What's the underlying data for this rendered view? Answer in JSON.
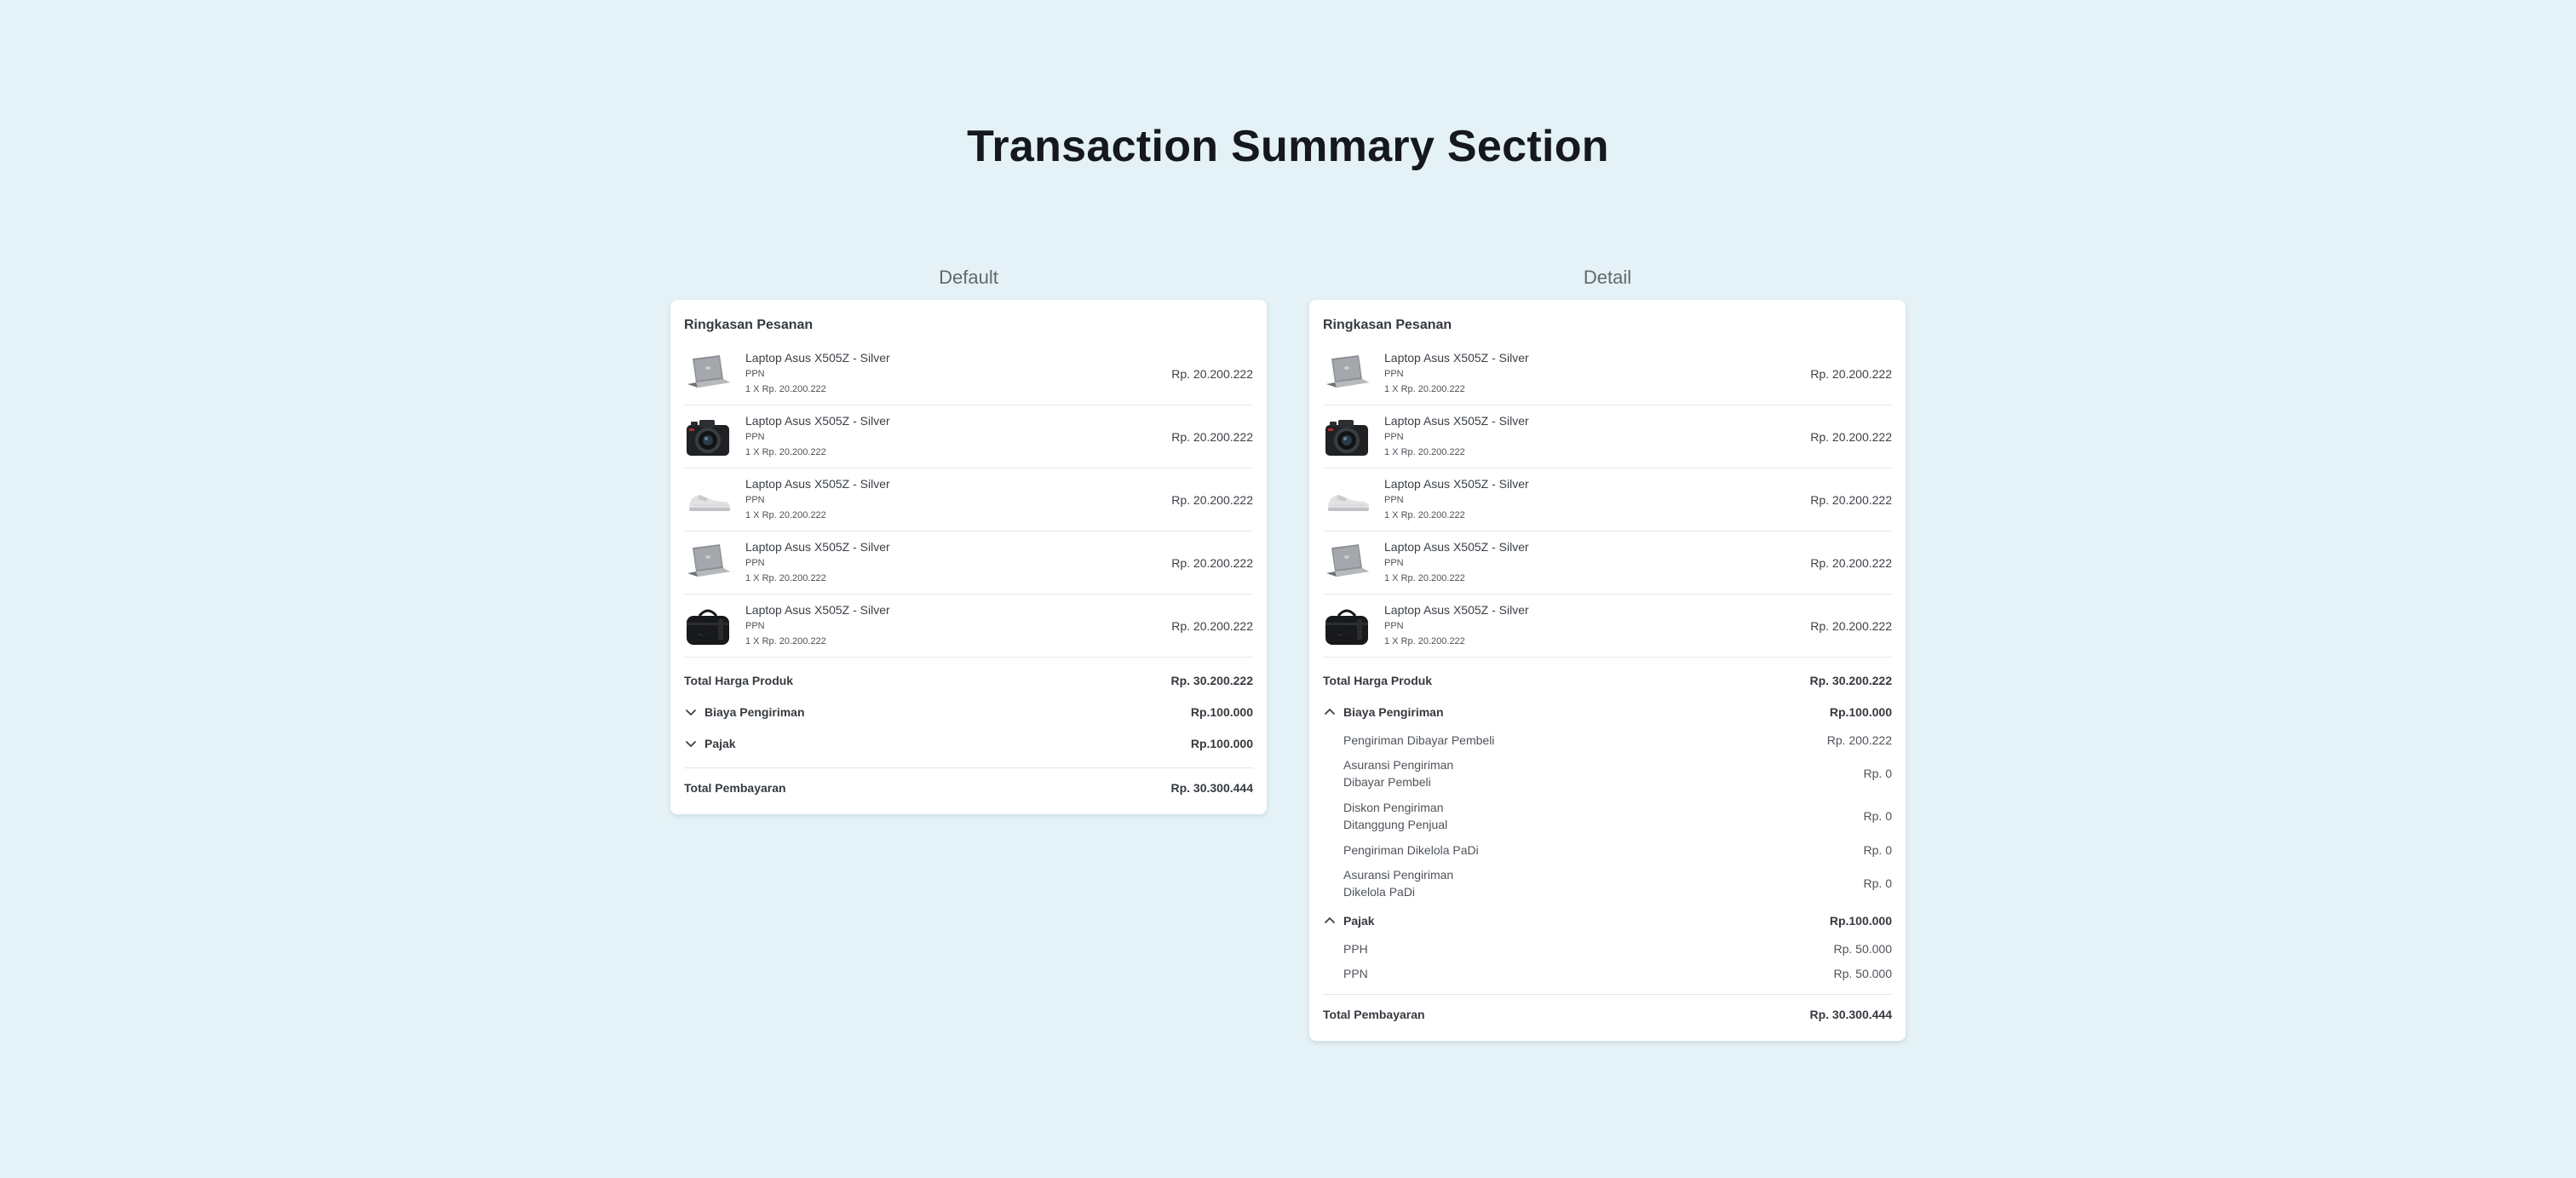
{
  "page_title": "Transaction Summary Section",
  "panels": [
    {
      "label": "Default",
      "card_title": "Ringkasan Pesanan",
      "items": [
        {
          "image": "laptop",
          "name": "Laptop Asus X505Z - Silver",
          "tax": "PPN",
          "qty_price": "1 X Rp. 20.200.222",
          "price": "Rp. 20.200.222"
        },
        {
          "image": "camera",
          "name": "Laptop Asus X505Z - Silver",
          "tax": "PPN",
          "qty_price": "1 X Rp. 20.200.222",
          "price": "Rp. 20.200.222"
        },
        {
          "image": "sneaker",
          "name": "Laptop Asus X505Z - Silver",
          "tax": "PPN",
          "qty_price": "1 X Rp. 20.200.222",
          "price": "Rp. 20.200.222"
        },
        {
          "image": "laptop",
          "name": "Laptop Asus X505Z - Silver",
          "tax": "PPN",
          "qty_price": "1 X Rp. 20.200.222",
          "price": "Rp. 20.200.222"
        },
        {
          "image": "duffel-bag",
          "name": "Laptop Asus X505Z - Silver",
          "tax": "PPN",
          "qty_price": "1 X Rp. 20.200.222",
          "price": "Rp. 20.200.222"
        }
      ],
      "total_product": {
        "label": "Total Harga Produk",
        "value": "Rp. 30.200.222"
      },
      "shipping": {
        "label": "Biaya Pengiriman",
        "value": "Rp.100.000",
        "expanded": false,
        "details": []
      },
      "tax": {
        "label": "Pajak",
        "value": "Rp.100.000",
        "expanded": false,
        "details": []
      },
      "total_payment": {
        "label": "Total Pembayaran",
        "value": "Rp. 30.300.444"
      }
    },
    {
      "label": "Detail",
      "card_title": "Ringkasan Pesanan",
      "items": [
        {
          "image": "laptop",
          "name": "Laptop Asus X505Z - Silver",
          "tax": "PPN",
          "qty_price": "1 X Rp. 20.200.222",
          "price": "Rp. 20.200.222"
        },
        {
          "image": "camera",
          "name": "Laptop Asus X505Z - Silver",
          "tax": "PPN",
          "qty_price": "1 X Rp. 20.200.222",
          "price": "Rp. 20.200.222"
        },
        {
          "image": "sneaker",
          "name": "Laptop Asus X505Z - Silver",
          "tax": "PPN",
          "qty_price": "1 X Rp. 20.200.222",
          "price": "Rp. 20.200.222"
        },
        {
          "image": "laptop",
          "name": "Laptop Asus X505Z - Silver",
          "tax": "PPN",
          "qty_price": "1 X Rp. 20.200.222",
          "price": "Rp. 20.200.222"
        },
        {
          "image": "duffel-bag",
          "name": "Laptop Asus X505Z - Silver",
          "tax": "PPN",
          "qty_price": "1 X Rp. 20.200.222",
          "price": "Rp. 20.200.222"
        }
      ],
      "total_product": {
        "label": "Total Harga Produk",
        "value": "Rp. 30.200.222"
      },
      "shipping": {
        "label": "Biaya Pengiriman",
        "value": "Rp.100.000",
        "expanded": true,
        "details": [
          {
            "lines": [
              "Pengiriman Dibayar Pembeli"
            ],
            "value": "Rp. 200.222"
          },
          {
            "lines": [
              "Asuransi Pengiriman",
              "Dibayar Pembeli"
            ],
            "value": "Rp. 0"
          },
          {
            "lines": [
              "Diskon Pengiriman",
              "Ditanggung Penjual"
            ],
            "value": "Rp. 0"
          },
          {
            "lines": [
              "Pengiriman Dikelola PaDi"
            ],
            "value": "Rp. 0"
          },
          {
            "lines": [
              "Asuransi Pengiriman",
              "Dikelola PaDi"
            ],
            "value": "Rp. 0"
          }
        ]
      },
      "tax": {
        "label": "Pajak",
        "value": "Rp.100.000",
        "expanded": true,
        "details": [
          {
            "lines": [
              "PPH"
            ],
            "value": "Rp. 50.000"
          },
          {
            "lines": [
              "PPN"
            ],
            "value": "Rp. 50.000"
          }
        ]
      },
      "total_payment": {
        "label": "Total Pembayaran",
        "value": "Rp. 30.300.444"
      }
    }
  ]
}
